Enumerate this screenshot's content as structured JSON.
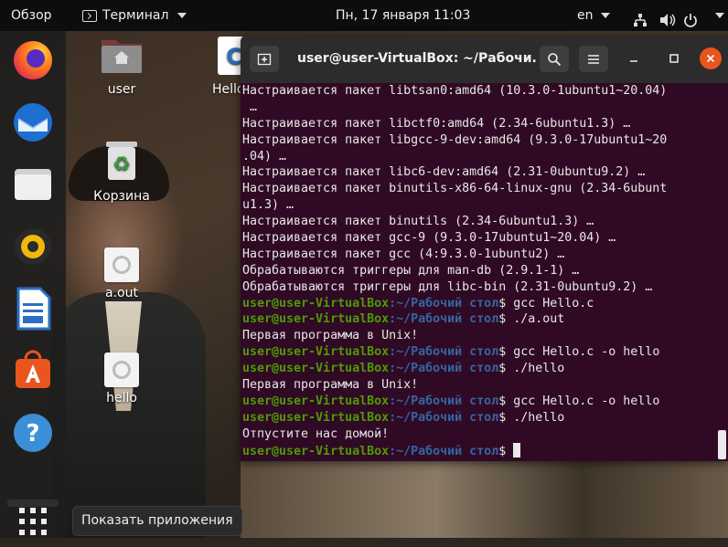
{
  "topbar": {
    "overview": "Обзор",
    "app_name": "Терминал",
    "clock": "Пн, 17 января  11:03",
    "lang": "en"
  },
  "dock": {
    "items": [
      "firefox-icon",
      "thunderbird-icon",
      "files-icon",
      "rhythmbox-icon",
      "libreoffice-writer-icon",
      "software-center-icon",
      "help-icon"
    ],
    "show_apps_tooltip": "Показать приложения"
  },
  "desktop": {
    "icons": [
      {
        "label": "user"
      },
      {
        "label": "Корзина"
      },
      {
        "label": "a.out"
      },
      {
        "label": "hello"
      },
      {
        "label": "Hello"
      }
    ]
  },
  "terminal": {
    "title": "user@user-VirtualBox: ~/Рабочи...",
    "prompt_user": "user@user-VirtualBox",
    "prompt_path": ":~/Рабочий стол",
    "prompt_sign": "$ ",
    "lines": [
      {
        "type": "out",
        "text": "Настраивается пакет libtsan0:amd64 (10.3.0-1ubuntu1~20.04)"
      },
      {
        "type": "out",
        "text": " …"
      },
      {
        "type": "out",
        "text": "Настраивается пакет libctf0:amd64 (2.34-6ubuntu1.3) …"
      },
      {
        "type": "out",
        "text": "Настраивается пакет libgcc-9-dev:amd64 (9.3.0-17ubuntu1~20"
      },
      {
        "type": "out",
        "text": ".04) …"
      },
      {
        "type": "out",
        "text": "Настраивается пакет libc6-dev:amd64 (2.31-0ubuntu9.2) …"
      },
      {
        "type": "out",
        "text": "Настраивается пакет binutils-x86-64-linux-gnu (2.34-6ubunt"
      },
      {
        "type": "out",
        "text": "u1.3) …"
      },
      {
        "type": "out",
        "text": "Настраивается пакет binutils (2.34-6ubuntu1.3) …"
      },
      {
        "type": "out",
        "text": "Настраивается пакет gcc-9 (9.3.0-17ubuntu1~20.04) …"
      },
      {
        "type": "out",
        "text": "Настраивается пакет gcc (4:9.3.0-1ubuntu2) …"
      },
      {
        "type": "out",
        "text": "Обрабатываются триггеры для man-db (2.9.1-1) …"
      },
      {
        "type": "out",
        "text": "Обрабатываются триггеры для libc-bin (2.31-0ubuntu9.2) …"
      },
      {
        "type": "cmd",
        "text": "gcc Hello.c"
      },
      {
        "type": "cmd",
        "text": "./a.out"
      },
      {
        "type": "out",
        "text": "Первая программа в Unix!"
      },
      {
        "type": "cmd",
        "text": "gcc Hello.c -o hello"
      },
      {
        "type": "cmd",
        "text": "./hello"
      },
      {
        "type": "out",
        "text": "Первая программа в Unix!"
      },
      {
        "type": "cmd",
        "text": "gcc Hello.c -o hello"
      },
      {
        "type": "cmd",
        "text": "./hello"
      },
      {
        "type": "out",
        "text": "Отпустите нас домой!"
      },
      {
        "type": "cmd",
        "text": ""
      }
    ]
  },
  "colors": {
    "terminal_bg": "#300a24",
    "prompt_user": "#4e9a06",
    "prompt_path": "#3465a4",
    "accent": "#e9541f"
  }
}
